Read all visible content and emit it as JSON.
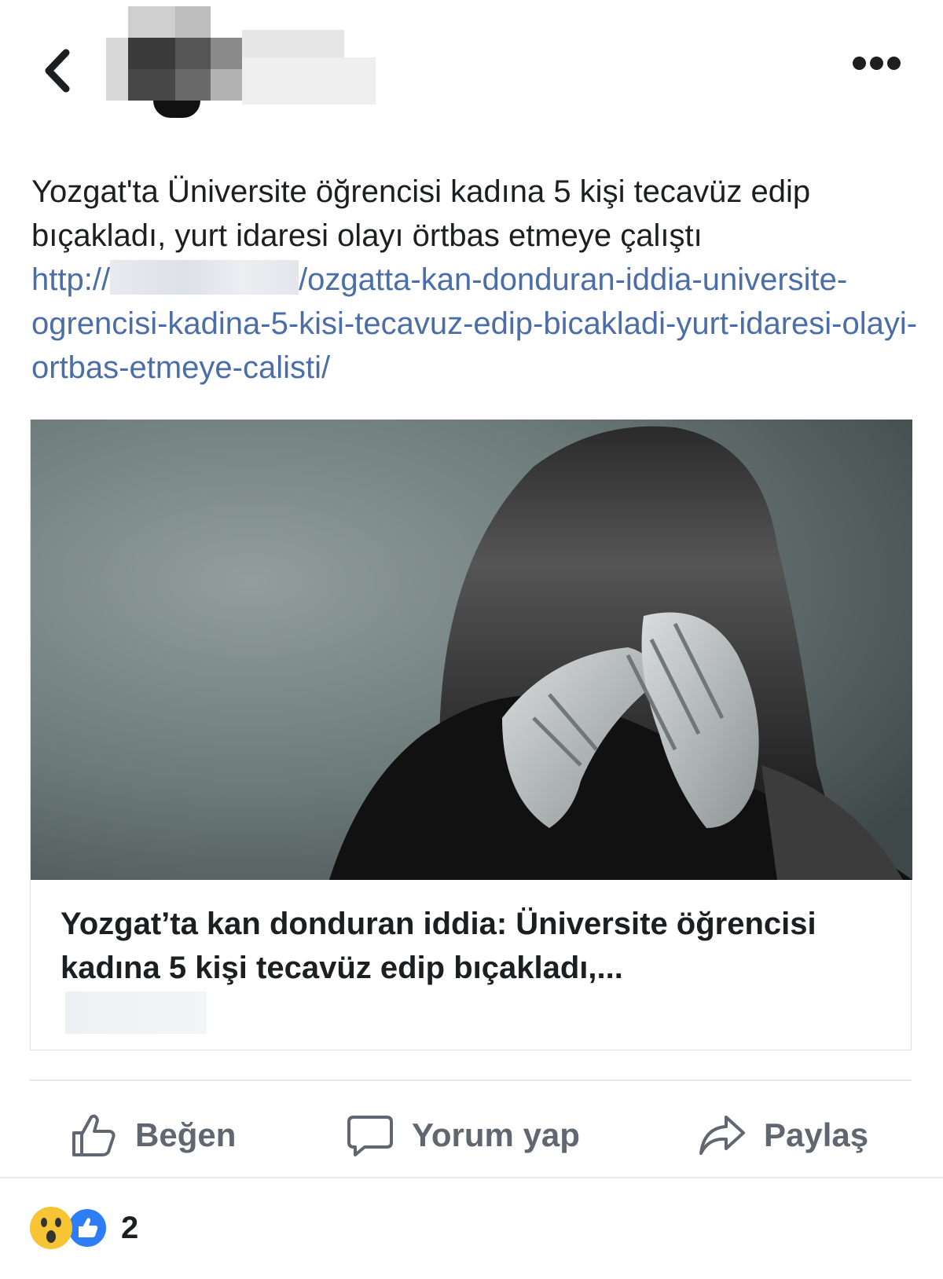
{
  "post": {
    "text": "Yozgat'ta Üniversite öğrencisi kadına 5 kişi tecavüz edip bıçakladı, yurt idaresi olayı örtbas etmeye çalıştı",
    "link_prefix": "http://",
    "link_suffix": "/ozgatta-kan-donduran-iddia-universite-ogrencisi-kadina-5-kisi-tecavuz-edip-bicakladi-yurt-idaresi-olayi-ortbas-etmeye-calisti/"
  },
  "card": {
    "title": "Yozgat’ta kan donduran iddia: Üniversite öğrencisi kadına 5 kişi tecavüz edip bıçakladı,..."
  },
  "actions": {
    "like_label": "Beğen",
    "comment_label": "Yorum yap",
    "share_label": "Paylaş"
  },
  "reactions": {
    "count": "2"
  },
  "colors": {
    "link": "#4b6ea9",
    "action_gray": "#606770",
    "like_blue": "#2e7cf6",
    "wow_yellow": "#f7c533"
  }
}
